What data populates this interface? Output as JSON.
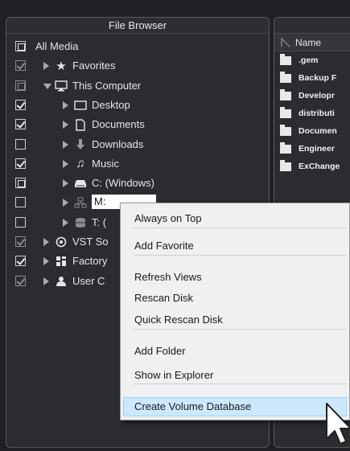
{
  "file_browser": {
    "title": "File Browser",
    "items": [
      {
        "label": "All Media",
        "checkbox": "partial",
        "dim": false,
        "arrow": "none",
        "icon": "none",
        "icon_name": "none"
      },
      {
        "label": "Favorites",
        "checkbox": "checked",
        "dim": true,
        "arrow": "right",
        "icon": "★",
        "icon_name": "star-icon"
      },
      {
        "label": "This Computer",
        "checkbox": "partial",
        "dim": true,
        "arrow": "down",
        "icon": "monitor",
        "icon_name": "monitor-icon"
      },
      {
        "label": "Desktop",
        "checkbox": "checked",
        "dim": false,
        "arrow": "right",
        "icon": "desktop",
        "icon_name": "desktop-icon"
      },
      {
        "label": "Documents",
        "checkbox": "checked",
        "dim": false,
        "arrow": "right",
        "icon": "document",
        "icon_name": "document-icon"
      },
      {
        "label": "Downloads",
        "checkbox": "empty",
        "dim": false,
        "arrow": "right",
        "icon": "download",
        "icon_name": "download-icon"
      },
      {
        "label": "Music",
        "checkbox": "checked",
        "dim": false,
        "arrow": "right",
        "icon": "♫",
        "icon_name": "music-icon"
      },
      {
        "label": "C: (Windows)",
        "checkbox": "partial",
        "dim": false,
        "arrow": "right",
        "icon": "drive",
        "icon_name": "drive-icon"
      },
      {
        "label": "M:",
        "checkbox": "empty",
        "dim": false,
        "arrow": "right",
        "icon": "network",
        "icon_name": "network-drive-icon"
      },
      {
        "label": "T: (",
        "checkbox": "empty",
        "dim": false,
        "arrow": "right",
        "icon": "database",
        "icon_name": "database-drive-icon"
      },
      {
        "label": "VST So",
        "checkbox": "checked",
        "dim": true,
        "arrow": "right",
        "icon": "vst",
        "icon_name": "vst-sound-icon"
      },
      {
        "label": "Factory",
        "checkbox": "checked",
        "dim": false,
        "arrow": "right",
        "icon": "factory",
        "icon_name": "factory-content-icon"
      },
      {
        "label": "User C",
        "checkbox": "checked",
        "dim": true,
        "arrow": "right",
        "icon": "user",
        "icon_name": "user-icon"
      }
    ]
  },
  "right_panel": {
    "column_header": "Name",
    "files": [
      ".gem",
      "Backup F",
      "Developr",
      "distributi",
      "Documen",
      "Engineer",
      "ExChange"
    ]
  },
  "context_menu": {
    "items": [
      {
        "label": "Always on Top",
        "highlighted": false
      },
      {
        "separator": true
      },
      {
        "label": "Add Favorite",
        "highlighted": false
      },
      {
        "separator": true
      },
      {
        "label": "Refresh Views",
        "highlighted": false
      },
      {
        "label": "Rescan Disk",
        "highlighted": false
      },
      {
        "label": "Quick Rescan Disk",
        "highlighted": false
      },
      {
        "separator": true
      },
      {
        "label": "Add Folder",
        "highlighted": false
      },
      {
        "label": "Show in Explorer",
        "highlighted": false
      },
      {
        "separator": true
      },
      {
        "label": "Create Volume Database",
        "highlighted": true
      }
    ]
  },
  "colors": {
    "background": "#1f2124",
    "panel": "#2a2c30",
    "menu_bg": "#f0f0f0",
    "menu_highlight": "#cce8ff"
  }
}
